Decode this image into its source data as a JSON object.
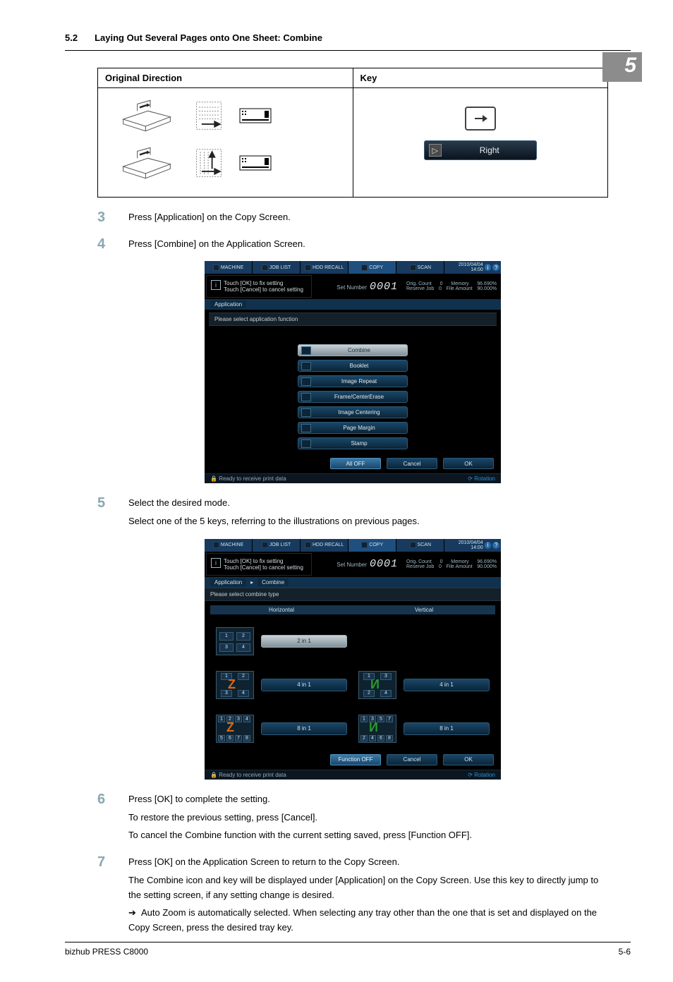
{
  "header": {
    "section_number": "5.2",
    "section_title": "Laying Out Several Pages onto One Sheet: Combine"
  },
  "chapter_tab": "5",
  "odk": {
    "left_header": "Original Direction",
    "right_header": "Key",
    "key_button_label": "Right"
  },
  "steps": {
    "s3": {
      "num": "3",
      "text": "Press [Application] on the Copy Screen."
    },
    "s4": {
      "num": "4",
      "text": "Press [Combine] on the Application Screen."
    },
    "s5": {
      "num": "5",
      "text": "Select the desired mode.",
      "sub": "Select one of the 5 keys, referring to the illustrations on previous pages."
    },
    "s6": {
      "num": "6",
      "text": "Press [OK] to complete the setting.",
      "sub1": "To restore the previous setting, press [Cancel].",
      "sub2": "To cancel the Combine function with the current setting saved, press [Function OFF]."
    },
    "s7": {
      "num": "7",
      "text": "Press [OK] on the Application Screen to return to the Copy Screen.",
      "sub1": "The Combine icon and key will be displayed under [Application] on the Copy Screen. Use this key to directly jump to the setting screen, if any setting change is desired.",
      "bullet": "Auto Zoom is automatically selected. When selecting any tray other than the one that is set and displayed on the Copy Screen, press the desired tray key."
    }
  },
  "screen": {
    "tabs": {
      "machine": "MACHINE",
      "joblist": "JOB LIST",
      "hddrecall": "HDD RECALL",
      "copy": "COPY",
      "scan": "SCAN"
    },
    "timestamp": "2010/04/04 14:00",
    "info_msg_1": "Touch [OK] to fix setting",
    "info_msg_2": "Touch [Cancel] to cancel setting",
    "set_number_label": "Set Number",
    "set_number_value": "0001",
    "right_info": {
      "orig_count_lbl": "Orig. Count",
      "orig_count_val": "0",
      "reserve_lbl": "Reserve Job",
      "reserve_val": "0",
      "mem_lbl": "Memory",
      "mem_val": "96.690%",
      "file_lbl": "File Amount",
      "file_val": "90.000%"
    },
    "crumb_app": "Application",
    "crumb_combine": "Combine",
    "hint_app": "Please select application function",
    "hint_combine": "Please select combine type",
    "app_buttons": [
      "Combine",
      "Booklet",
      "Image Repeat",
      "Frame/CenterErase",
      "Image Centering",
      "Page Margin",
      "Stamp"
    ],
    "combine": {
      "horizontal": "Horizontal",
      "vertical": "Vertical",
      "b2": "2 in 1",
      "b4": "4 in 1",
      "b8": "8 in 1"
    },
    "bottom": {
      "alloff": "All OFF",
      "funcoff": "Function OFF",
      "cancel": "Cancel",
      "ok": "OK"
    },
    "status": "Ready to receive print data",
    "rotation": "Rotation"
  },
  "footer": {
    "left": "bizhub PRESS C8000",
    "right": "5-6"
  }
}
